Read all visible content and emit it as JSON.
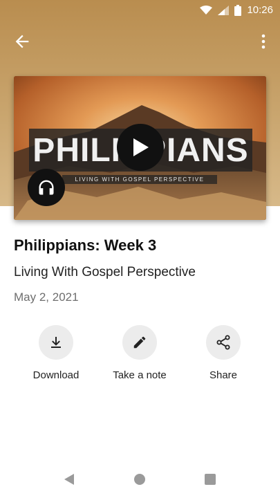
{
  "status_bar": {
    "time": "10:26"
  },
  "media": {
    "title_text": "PHILIPPIANS",
    "subtitle_text": "LIVING WITH GOSPEL PERSPECTIVE"
  },
  "sermon": {
    "title": "Philippians: Week 3",
    "subtitle": "Living With Gospel Perspective",
    "date": "May 2, 2021"
  },
  "actions": {
    "download_label": "Download",
    "note_label": "Take a note",
    "share_label": "Share"
  },
  "icons": {
    "back": "arrow-left-icon",
    "menu": "more-vert-icon",
    "play": "play-icon",
    "audio": "headphones-icon",
    "download": "download-icon",
    "note": "pencil-icon",
    "share": "share-icon"
  },
  "colors": {
    "header": "#c9a56e",
    "button_bg": "#ececec",
    "media_buttons": "#111111"
  }
}
